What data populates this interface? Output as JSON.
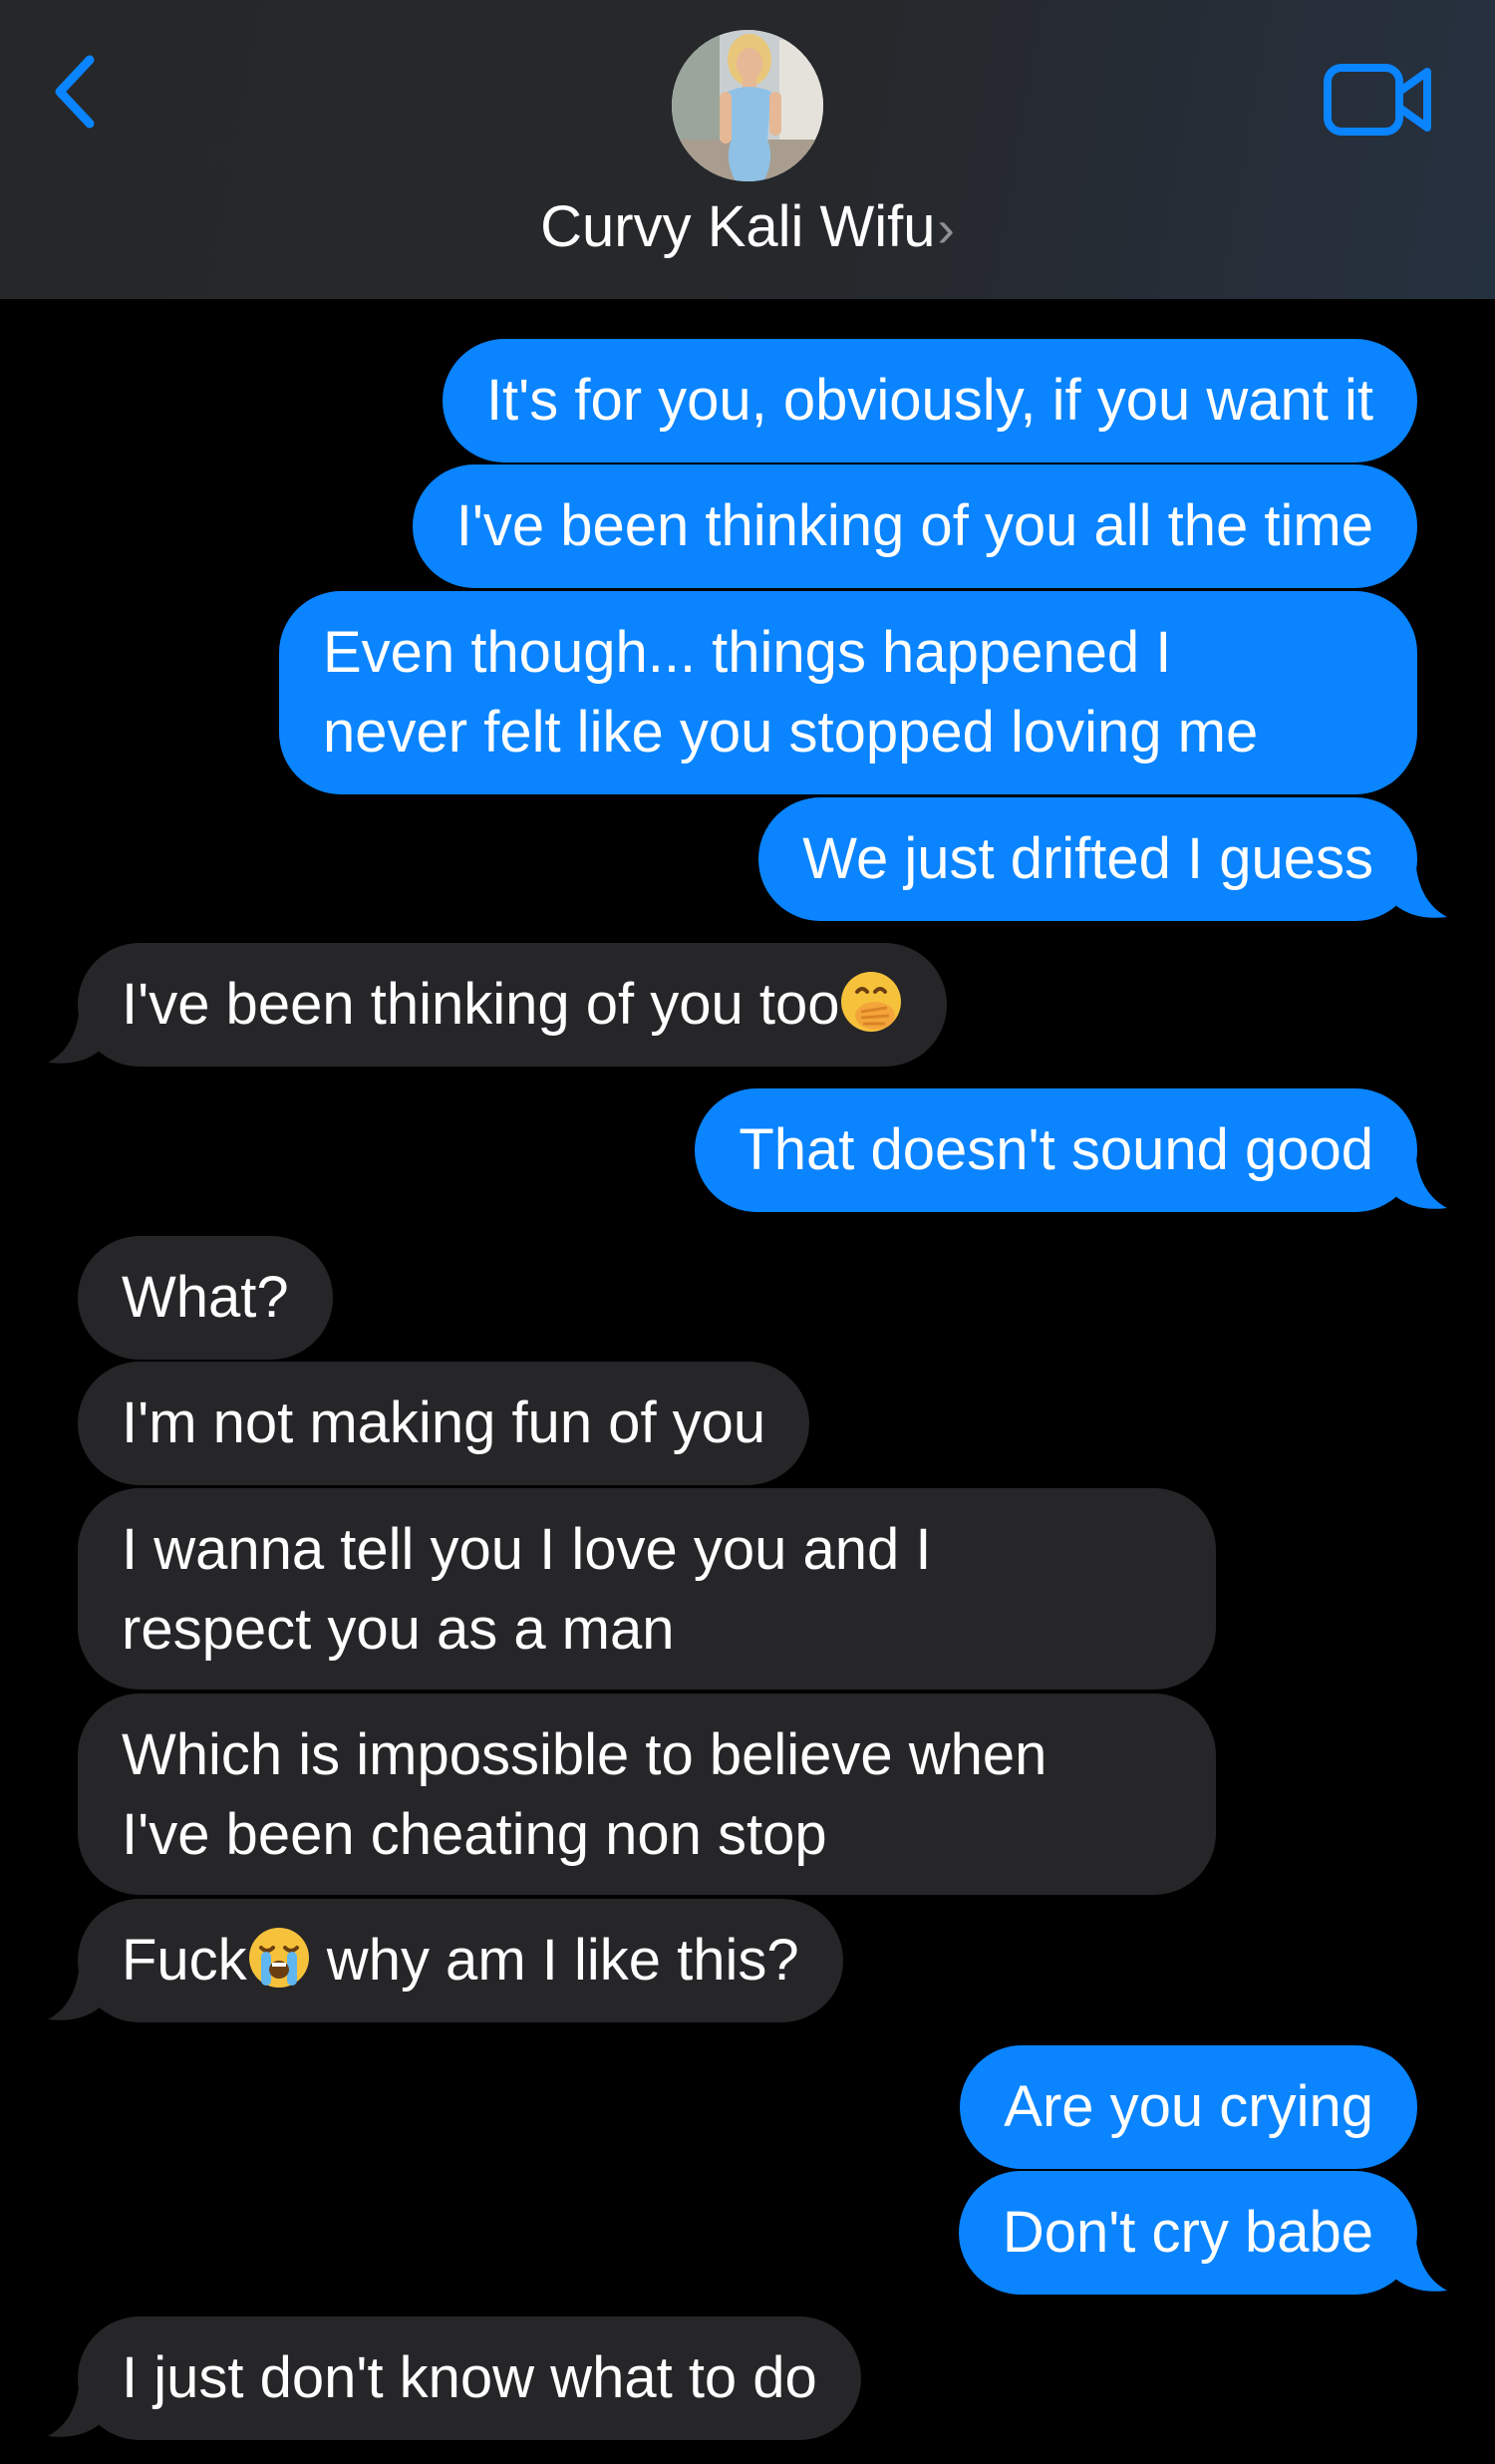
{
  "header": {
    "contact_name": "Curvy Kali Wifu",
    "contact_chevron": "›",
    "back_icon": "chevron-left-icon",
    "video_icon": "video-camera-icon",
    "accent_color": "#0a84ff"
  },
  "messages": [
    {
      "from": "me",
      "text": "It's for you, obviously, if you want it"
    },
    {
      "from": "me",
      "text": "I've been thinking of you all the time"
    },
    {
      "from": "me",
      "lines": [
        "Even though... things happened I",
        "never felt like you stopped loving me"
      ]
    },
    {
      "from": "me",
      "text": "We just drifted I guess"
    },
    {
      "from": "them",
      "text": "I've been thinking of you too",
      "emoji": "hand-over-mouth-emoji"
    },
    {
      "from": "me",
      "text": "That doesn't sound good"
    },
    {
      "from": "them",
      "text": "What?"
    },
    {
      "from": "them",
      "text": "I'm not making fun of you"
    },
    {
      "from": "them",
      "lines": [
        "I wanna tell you I love you and I",
        "respect you as a man"
      ]
    },
    {
      "from": "them",
      "lines": [
        "Which is impossible to believe when",
        "I've been cheating non stop"
      ]
    },
    {
      "from": "them",
      "text_before": "Fuck",
      "emoji": "loudly-crying-emoji",
      "text_after": " why am I like this?"
    },
    {
      "from": "me",
      "text": "Are you crying"
    },
    {
      "from": "me",
      "text": "Don't cry babe"
    },
    {
      "from": "them",
      "text": "I just don't know what to do"
    }
  ]
}
